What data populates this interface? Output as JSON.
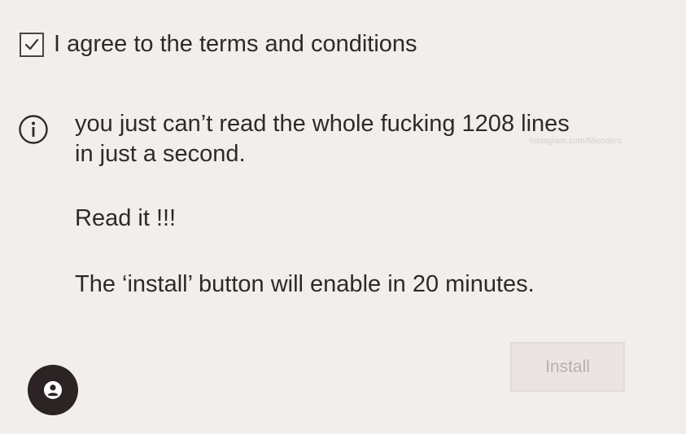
{
  "agreement": {
    "label": "I agree to the terms and conditions",
    "checked": true,
    "check_icon": "checkmark-icon"
  },
  "info": {
    "icon": "info-icon",
    "line1": "you just can’t read the whole fucking 1208 lines",
    "line2": "in just a second.",
    "read_it": "Read it !!!",
    "install_notice": "The ‘install’ button will enable in 20 minutes."
  },
  "watermark": "Instagram.com/69coders",
  "install_button": {
    "label": "Install",
    "enabled": false
  },
  "avatar": {
    "icon": "user-icon"
  },
  "colors": {
    "background": "#f2eeec",
    "text": "#2e2a2a",
    "button_disabled_bg": "#ece4e2",
    "button_disabled_text": "#b7b0ae",
    "avatar_bg": "#2c2424"
  }
}
